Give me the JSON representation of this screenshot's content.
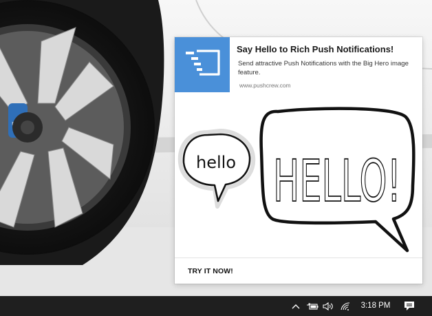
{
  "notification": {
    "app_logo_icon": "pushcrew-logo-icon",
    "title": "Say Hello to Rich Push Notifications!",
    "body": "Send attractive Push Notifications with the Big Hero image feature.",
    "source": "www.pushcrew.com",
    "hero_image": {
      "left_bubble_text": "hello",
      "right_bubble_text": "HELLO!"
    },
    "action_label": "TRY IT NOW!",
    "accent_color": "#4a90d9"
  },
  "taskbar": {
    "tray_icons": [
      "chevron-up-icon",
      "battery-icon",
      "volume-icon",
      "wifi-icon"
    ],
    "clock": "3:18 PM",
    "action_center_icon": "notification-center-icon",
    "background_color": "#1f1f1f"
  }
}
